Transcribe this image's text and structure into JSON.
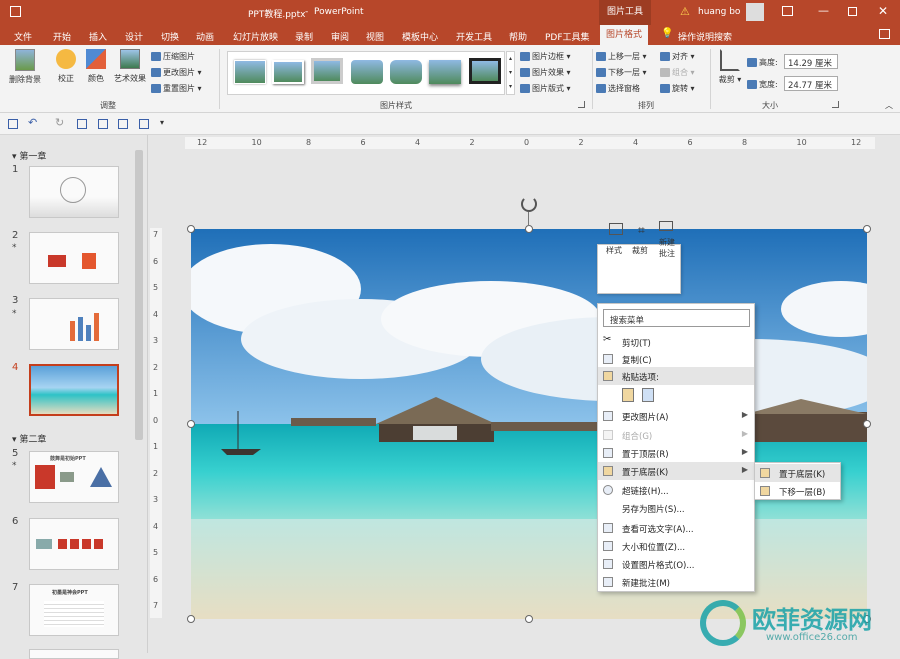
{
  "title": {
    "doc": "PPT教程.pptx",
    "sep": "-",
    "app": "PowerPoint",
    "context_tab": "图片工具",
    "user": "huang bo"
  },
  "tabs": [
    "文件",
    "开始",
    "插入",
    "设计",
    "切换",
    "动画",
    "幻灯片放映",
    "录制",
    "审阅",
    "视图",
    "模板中心",
    "开发工具",
    "帮助",
    "PDF工具集",
    "图片格式",
    "操作说明搜索"
  ],
  "ribbon": {
    "adjust": {
      "remove_bg": "删除背景",
      "correct": "校正",
      "color": "颜色",
      "art": "艺术效果",
      "compress": "压缩图片",
      "change": "更改图片",
      "reset": "重置图片",
      "label": "调整"
    },
    "styles": {
      "border": "图片边框",
      "effect": "图片效果",
      "layout": "图片版式",
      "label": "图片样式"
    },
    "arrange": {
      "forward": "上移一层",
      "backward": "下移一层",
      "pane": "选择窗格",
      "align": "对齐",
      "group": "组合",
      "rotate": "旋转",
      "label": "排列"
    },
    "size": {
      "crop": "裁剪",
      "height_label": "高度:",
      "height": "14.29 厘米",
      "width_label": "宽度:",
      "width": "24.77 厘米",
      "label": "大小"
    }
  },
  "slides": {
    "section1": "第一章",
    "section2": "第二章",
    "nums": [
      "1",
      "2",
      "3",
      "4",
      "5",
      "6",
      "7"
    ],
    "star": "*",
    "thumb5_title": "鼓舞是初始PPT",
    "thumb7_title": "初墨是神会PPT"
  },
  "ruler": {
    "h": [
      "12",
      "10",
      "8",
      "6",
      "4",
      "2",
      "0",
      "2",
      "4",
      "6",
      "8",
      "10",
      "12"
    ],
    "v": [
      "7",
      "6",
      "5",
      "4",
      "3",
      "2",
      "1",
      "0",
      "1",
      "2",
      "3",
      "4",
      "5",
      "6",
      "7"
    ]
  },
  "mini_toolbar": {
    "style": "样式",
    "crop": "裁剪",
    "comment": "新建批注"
  },
  "context_menu": {
    "search": "搜索菜单",
    "cut": "剪切(T)",
    "copy": "复制(C)",
    "paste_options": "粘贴选项:",
    "change_picture": "更改图片(A)",
    "group": "组合(G)",
    "bring_front": "置于顶层(R)",
    "send_back": "置于底层(K)",
    "hyperlink": "超链接(H)...",
    "save_as": "另存为图片(S)...",
    "alt_text": "查看可选文字(A)...",
    "size_position": "大小和位置(Z)...",
    "format_picture": "设置图片格式(O)...",
    "new_comment": "新建批注(M)"
  },
  "submenu": {
    "send_to_back": "置于底层(K)",
    "send_backward": "下移一层(B)"
  },
  "watermark": {
    "text": "欧菲资源网",
    "url": "www.office26.com"
  }
}
